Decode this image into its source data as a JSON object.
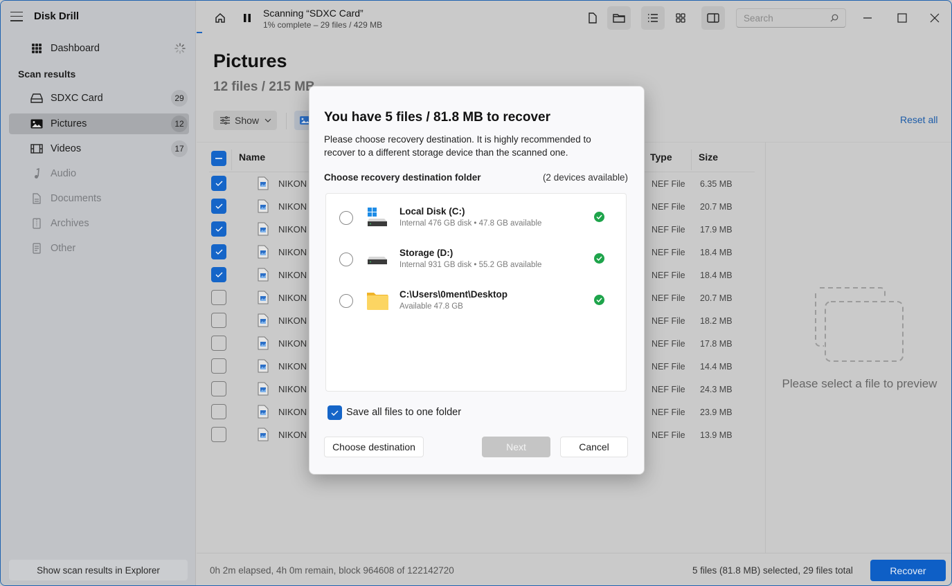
{
  "app": {
    "title": "Disk Drill"
  },
  "sidebar": {
    "dashboard_label": "Dashboard",
    "section_label": "Scan results",
    "items": [
      {
        "label": "SDXC Card",
        "count": "29",
        "icon": "drive-icon"
      },
      {
        "label": "Pictures",
        "count": "12",
        "icon": "picture-icon",
        "active": true
      },
      {
        "label": "Videos",
        "count": "17",
        "icon": "film-icon"
      },
      {
        "label": "Audio",
        "icon": "music-note-icon"
      },
      {
        "label": "Documents",
        "icon": "document-icon"
      },
      {
        "label": "Archives",
        "icon": "archive-icon"
      },
      {
        "label": "Other",
        "icon": "other-file-icon"
      }
    ],
    "explorer_button": "Show scan results in Explorer"
  },
  "topbar": {
    "scan_title": "Scanning “SDXC Card”",
    "scan_status": "1% complete – 29 files / 429 MB",
    "progress_percent": 1,
    "search_placeholder": "Search"
  },
  "main": {
    "title": "Pictures",
    "subtitle": "12 files / 215 MB",
    "show_label": "Show",
    "reset_all": "Reset all",
    "columns": {
      "name": "Name",
      "type": "Type",
      "size": "Size"
    },
    "rows": [
      {
        "name": "NIKON",
        "type": "NEF File",
        "size": "6.35 MB",
        "checked": true
      },
      {
        "name": "NIKON",
        "type": "NEF File",
        "size": "20.7 MB",
        "checked": true
      },
      {
        "name": "NIKON",
        "type": "NEF File",
        "size": "17.9 MB",
        "checked": true
      },
      {
        "name": "NIKON",
        "type": "NEF File",
        "size": "18.4 MB",
        "checked": true
      },
      {
        "name": "NIKON",
        "type": "NEF File",
        "size": "18.4 MB",
        "checked": true
      },
      {
        "name": "NIKON",
        "type": "NEF File",
        "size": "20.7 MB",
        "checked": false
      },
      {
        "name": "NIKON",
        "type": "NEF File",
        "size": "18.2 MB",
        "checked": false
      },
      {
        "name": "NIKON",
        "type": "NEF File",
        "size": "17.8 MB",
        "checked": false
      },
      {
        "name": "NIKON",
        "type": "NEF File",
        "size": "14.4 MB",
        "checked": false
      },
      {
        "name": "NIKON",
        "type": "NEF File",
        "size": "24.3 MB",
        "checked": false
      },
      {
        "name": "NIKON",
        "type": "NEF File",
        "size": "23.9 MB",
        "checked": false
      },
      {
        "name": "NIKON",
        "type": "NEF File",
        "size": "13.9 MB",
        "checked": false
      }
    ],
    "preview_text": "Please select a file to preview"
  },
  "status": {
    "left": "0h 2m elapsed, 4h 0m remain, block 964608 of 122142720",
    "right": "5 files (81.8 MB) selected, 29 files total",
    "recover_label": "Recover"
  },
  "modal": {
    "title": "You have 5 files / 81.8 MB to recover",
    "description": "Please choose recovery destination. It is highly recommended to recover to a different storage device than the scanned one.",
    "section_label": "Choose recovery destination folder",
    "devices_count": "(2 devices available)",
    "destinations": [
      {
        "name": "Local Disk (C:)",
        "info": "Internal 476 GB disk • 47.8 GB available",
        "icon": "windows-drive-icon",
        "status": "ok"
      },
      {
        "name": "Storage (D:)",
        "info": "Internal 931 GB disk • 55.2 GB available",
        "icon": "drive-icon",
        "status": "ok"
      },
      {
        "name": "C:\\Users\\0ment\\Desktop",
        "info": "Available 47.8 GB",
        "icon": "folder-icon",
        "status": "ok"
      }
    ],
    "save_one_folder_label": "Save all files to one folder",
    "save_one_folder_checked": true,
    "choose_destination": "Choose destination",
    "next": "Next",
    "cancel": "Cancel"
  },
  "colors": {
    "accent": "#1565c8",
    "ok": "#1ea44b",
    "link": "#1d5ca8"
  }
}
